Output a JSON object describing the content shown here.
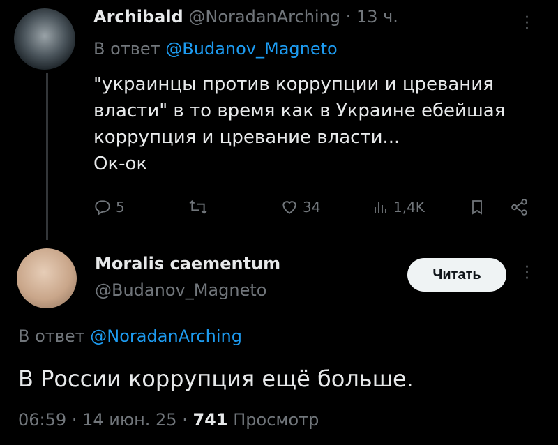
{
  "reply_tweet": {
    "author_name": "Archibald",
    "author_handle": "@NoradanArching",
    "separator": "·",
    "time": "13 ч.",
    "reply_prefix": "В ответ",
    "reply_to": "@Budanov_Magneto",
    "text_lines": [
      "\"украинцы против коррупции и цревания",
      "власти\" в то время как в Украине ебейшая",
      "коррупция и цревание власти...",
      "Ок-ок"
    ],
    "actions": {
      "replies": "5",
      "retweets": "",
      "likes": "34",
      "views": "1,4K"
    }
  },
  "main_tweet": {
    "author_name": "Moralis caementum",
    "author_handle": "@Budanov_Magneto",
    "follow_label": "Читать",
    "reply_prefix": "В ответ",
    "reply_to": "@NoradanArching",
    "text": "В России коррупция ещё больше.",
    "meta": {
      "time": "06:59",
      "sep1": "·",
      "date": "14 июн. 25",
      "sep2": "·",
      "views": "741",
      "views_label": "Просмотр"
    }
  },
  "icons": {
    "more": "more-vertical-icon",
    "reply": "reply-icon",
    "retweet": "retweet-icon",
    "like": "heart-icon",
    "views": "views-bar-icon",
    "bookmark": "bookmark-icon",
    "share": "share-icon"
  },
  "colors": {
    "background": "#000000",
    "text": "#e7e9ea",
    "muted": "#71767b",
    "link": "#1d9bf0",
    "button_bg": "#eff3f4"
  }
}
